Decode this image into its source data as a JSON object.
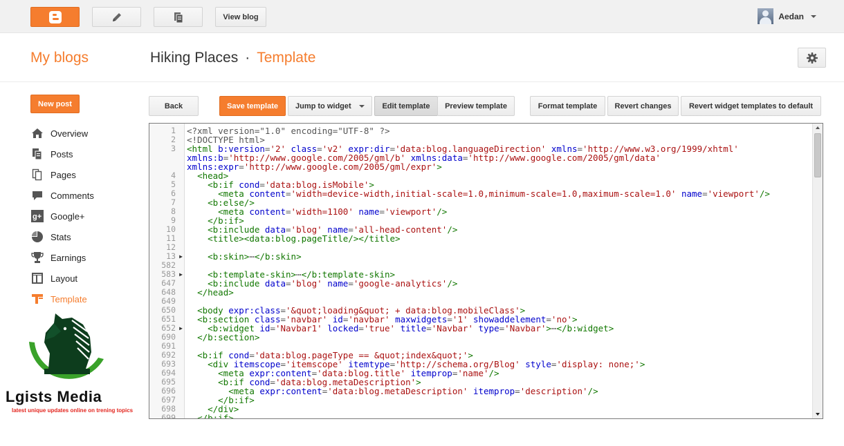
{
  "topbar": {
    "view_blog_label": "View blog",
    "user_name": "Aedan"
  },
  "header": {
    "my_blogs": "My blogs",
    "blog_name": "Hiking Places",
    "separator": "·",
    "page_name": "Template"
  },
  "sidebar": {
    "new_post_label": "New post",
    "items": [
      {
        "label": "Overview",
        "icon": "home-icon"
      },
      {
        "label": "Posts",
        "icon": "posts-icon"
      },
      {
        "label": "Pages",
        "icon": "pages-icon"
      },
      {
        "label": "Comments",
        "icon": "comments-icon"
      },
      {
        "label": "Google+",
        "icon": "google-plus-icon"
      },
      {
        "label": "Stats",
        "icon": "stats-icon"
      },
      {
        "label": "Earnings",
        "icon": "trophy-icon"
      },
      {
        "label": "Layout",
        "icon": "layout-icon"
      },
      {
        "label": "Template",
        "icon": "template-icon",
        "active": true
      }
    ]
  },
  "toolbar": {
    "back": "Back",
    "save": "Save template",
    "jump": "Jump to widget",
    "edit": "Edit template",
    "preview": "Preview template",
    "format": "Format template",
    "revert": "Revert changes",
    "revert_widgets": "Revert widget templates to default"
  },
  "logo": {
    "name": "Lgists Media",
    "tagline": "latest unique updates online on trening topics"
  },
  "colors": {
    "accent": "#f57d2e",
    "tag": "#117700",
    "attribute": "#0000cc",
    "string": "#aa1111"
  },
  "editor": {
    "lines": [
      {
        "n": "1",
        "fold": false,
        "tokens": [
          [
            "p",
            "<?xml version=\"1.0\" encoding=\"UTF-8\" ?>"
          ]
        ]
      },
      {
        "n": "2",
        "fold": false,
        "tokens": [
          [
            "p",
            "<!DOCTYPE html>"
          ]
        ]
      },
      {
        "n": "3",
        "fold": false,
        "tokens": [
          [
            "t",
            "<html "
          ],
          [
            "a",
            "b:version"
          ],
          [
            "p",
            "="
          ],
          [
            "s",
            "'2'"
          ],
          [
            "p",
            " "
          ],
          [
            "a",
            "class"
          ],
          [
            "p",
            "="
          ],
          [
            "s",
            "'v2'"
          ],
          [
            "p",
            " "
          ],
          [
            "a",
            "expr:dir"
          ],
          [
            "p",
            "="
          ],
          [
            "s",
            "'data:blog.languageDirection'"
          ],
          [
            "p",
            " "
          ],
          [
            "a",
            "xmlns"
          ],
          [
            "p",
            "="
          ],
          [
            "s",
            "'http://www.w3.org/1999/xhtml'"
          ]
        ]
      },
      {
        "n": "",
        "fold": false,
        "tokens": [
          [
            "a",
            "xmlns:b"
          ],
          [
            "p",
            "="
          ],
          [
            "s",
            "'http://www.google.com/2005/gml/b'"
          ],
          [
            "p",
            " "
          ],
          [
            "a",
            "xmlns:data"
          ],
          [
            "p",
            "="
          ],
          [
            "s",
            "'http://www.google.com/2005/gml/data'"
          ]
        ]
      },
      {
        "n": "",
        "fold": false,
        "tokens": [
          [
            "a",
            "xmlns:expr"
          ],
          [
            "p",
            "="
          ],
          [
            "s",
            "'http://www.google.com/2005/gml/expr'"
          ],
          [
            "t",
            ">"
          ]
        ]
      },
      {
        "n": "4",
        "fold": false,
        "tokens": [
          [
            "p",
            "  "
          ],
          [
            "t",
            "<head>"
          ]
        ]
      },
      {
        "n": "5",
        "fold": false,
        "tokens": [
          [
            "p",
            "    "
          ],
          [
            "t",
            "<b:if "
          ],
          [
            "a",
            "cond"
          ],
          [
            "p",
            "="
          ],
          [
            "s",
            "'data:blog.isMobile'"
          ],
          [
            "t",
            ">"
          ]
        ]
      },
      {
        "n": "6",
        "fold": false,
        "tokens": [
          [
            "p",
            "      "
          ],
          [
            "t",
            "<meta "
          ],
          [
            "a",
            "content"
          ],
          [
            "p",
            "="
          ],
          [
            "s",
            "'width=device-width,initial-scale=1.0,minimum-scale=1.0,maximum-scale=1.0'"
          ],
          [
            "p",
            " "
          ],
          [
            "a",
            "name"
          ],
          [
            "p",
            "="
          ],
          [
            "s",
            "'viewport'"
          ],
          [
            "t",
            "/>"
          ]
        ]
      },
      {
        "n": "7",
        "fold": false,
        "tokens": [
          [
            "p",
            "    "
          ],
          [
            "t",
            "<b:else/>"
          ]
        ]
      },
      {
        "n": "8",
        "fold": false,
        "tokens": [
          [
            "p",
            "      "
          ],
          [
            "t",
            "<meta "
          ],
          [
            "a",
            "content"
          ],
          [
            "p",
            "="
          ],
          [
            "s",
            "'width=1100'"
          ],
          [
            "p",
            " "
          ],
          [
            "a",
            "name"
          ],
          [
            "p",
            "="
          ],
          [
            "s",
            "'viewport'"
          ],
          [
            "t",
            "/>"
          ]
        ]
      },
      {
        "n": "9",
        "fold": false,
        "tokens": [
          [
            "p",
            "    "
          ],
          [
            "t",
            "</b:if>"
          ]
        ]
      },
      {
        "n": "10",
        "fold": false,
        "tokens": [
          [
            "p",
            "    "
          ],
          [
            "t",
            "<b:include "
          ],
          [
            "a",
            "data"
          ],
          [
            "p",
            "="
          ],
          [
            "s",
            "'blog'"
          ],
          [
            "p",
            " "
          ],
          [
            "a",
            "name"
          ],
          [
            "p",
            "="
          ],
          [
            "s",
            "'all-head-content'"
          ],
          [
            "t",
            "/>"
          ]
        ]
      },
      {
        "n": "11",
        "fold": false,
        "tokens": [
          [
            "p",
            "    "
          ],
          [
            "t",
            "<title>"
          ],
          [
            "t",
            "<data:blog.pageTitle/>"
          ],
          [
            "t",
            "</title>"
          ]
        ]
      },
      {
        "n": "12",
        "fold": false,
        "tokens": []
      },
      {
        "n": "13",
        "fold": true,
        "tokens": [
          [
            "p",
            "    "
          ],
          [
            "t",
            "<b:skin>"
          ],
          [
            "p",
            "⋯"
          ],
          [
            "t",
            "</b:skin>"
          ]
        ]
      },
      {
        "n": "582",
        "fold": false,
        "tokens": []
      },
      {
        "n": "583",
        "fold": true,
        "tokens": [
          [
            "p",
            "    "
          ],
          [
            "t",
            "<b:template-skin>"
          ],
          [
            "p",
            "⋯"
          ],
          [
            "t",
            "</b:template-skin>"
          ]
        ]
      },
      {
        "n": "647",
        "fold": false,
        "tokens": [
          [
            "p",
            "    "
          ],
          [
            "t",
            "<b:include "
          ],
          [
            "a",
            "data"
          ],
          [
            "p",
            "="
          ],
          [
            "s",
            "'blog'"
          ],
          [
            "p",
            " "
          ],
          [
            "a",
            "name"
          ],
          [
            "p",
            "="
          ],
          [
            "s",
            "'google-analytics'"
          ],
          [
            "t",
            "/>"
          ]
        ]
      },
      {
        "n": "648",
        "fold": false,
        "tokens": [
          [
            "p",
            "  "
          ],
          [
            "t",
            "</head>"
          ]
        ]
      },
      {
        "n": "649",
        "fold": false,
        "tokens": []
      },
      {
        "n": "650",
        "fold": false,
        "tokens": [
          [
            "p",
            "  "
          ],
          [
            "t",
            "<body "
          ],
          [
            "a",
            "expr:class"
          ],
          [
            "p",
            "="
          ],
          [
            "s",
            "'&quot;loading&quot; + data:blog.mobileClass'"
          ],
          [
            "t",
            ">"
          ]
        ]
      },
      {
        "n": "651",
        "fold": false,
        "tokens": [
          [
            "p",
            "  "
          ],
          [
            "t",
            "<b:section "
          ],
          [
            "a",
            "class"
          ],
          [
            "p",
            "="
          ],
          [
            "s",
            "'navbar'"
          ],
          [
            "p",
            " "
          ],
          [
            "a",
            "id"
          ],
          [
            "p",
            "="
          ],
          [
            "s",
            "'navbar'"
          ],
          [
            "p",
            " "
          ],
          [
            "a",
            "maxwidgets"
          ],
          [
            "p",
            "="
          ],
          [
            "s",
            "'1'"
          ],
          [
            "p",
            " "
          ],
          [
            "a",
            "showaddelement"
          ],
          [
            "p",
            "="
          ],
          [
            "s",
            "'no'"
          ],
          [
            "t",
            ">"
          ]
        ]
      },
      {
        "n": "652",
        "fold": true,
        "tokens": [
          [
            "p",
            "    "
          ],
          [
            "t",
            "<b:widget "
          ],
          [
            "a",
            "id"
          ],
          [
            "p",
            "="
          ],
          [
            "s",
            "'Navbar1'"
          ],
          [
            "p",
            " "
          ],
          [
            "a",
            "locked"
          ],
          [
            "p",
            "="
          ],
          [
            "s",
            "'true'"
          ],
          [
            "p",
            " "
          ],
          [
            "a",
            "title"
          ],
          [
            "p",
            "="
          ],
          [
            "s",
            "'Navbar'"
          ],
          [
            "p",
            " "
          ],
          [
            "a",
            "type"
          ],
          [
            "p",
            "="
          ],
          [
            "s",
            "'Navbar'"
          ],
          [
            "t",
            ">"
          ],
          [
            "p",
            "⋯"
          ],
          [
            "t",
            "</b:widget>"
          ]
        ]
      },
      {
        "n": "690",
        "fold": false,
        "tokens": [
          [
            "p",
            "  "
          ],
          [
            "t",
            "</b:section>"
          ]
        ]
      },
      {
        "n": "691",
        "fold": false,
        "tokens": []
      },
      {
        "n": "692",
        "fold": false,
        "tokens": [
          [
            "p",
            "  "
          ],
          [
            "t",
            "<b:if "
          ],
          [
            "a",
            "cond"
          ],
          [
            "p",
            "="
          ],
          [
            "s",
            "'data:blog.pageType == &quot;index&quot;'"
          ],
          [
            "t",
            ">"
          ]
        ]
      },
      {
        "n": "693",
        "fold": false,
        "tokens": [
          [
            "p",
            "    "
          ],
          [
            "t",
            "<div "
          ],
          [
            "a",
            "itemscope"
          ],
          [
            "p",
            "="
          ],
          [
            "s",
            "'itemscope'"
          ],
          [
            "p",
            " "
          ],
          [
            "a",
            "itemtype"
          ],
          [
            "p",
            "="
          ],
          [
            "s",
            "'http://schema.org/Blog'"
          ],
          [
            "p",
            " "
          ],
          [
            "a",
            "style"
          ],
          [
            "p",
            "="
          ],
          [
            "s",
            "'display: none;'"
          ],
          [
            "t",
            ">"
          ]
        ]
      },
      {
        "n": "694",
        "fold": false,
        "tokens": [
          [
            "p",
            "      "
          ],
          [
            "t",
            "<meta "
          ],
          [
            "a",
            "expr:content"
          ],
          [
            "p",
            "="
          ],
          [
            "s",
            "'data:blog.title'"
          ],
          [
            "p",
            " "
          ],
          [
            "a",
            "itemprop"
          ],
          [
            "p",
            "="
          ],
          [
            "s",
            "'name'"
          ],
          [
            "t",
            "/>"
          ]
        ]
      },
      {
        "n": "695",
        "fold": false,
        "tokens": [
          [
            "p",
            "      "
          ],
          [
            "t",
            "<b:if "
          ],
          [
            "a",
            "cond"
          ],
          [
            "p",
            "="
          ],
          [
            "s",
            "'data:blog.metaDescription'"
          ],
          [
            "t",
            ">"
          ]
        ]
      },
      {
        "n": "696",
        "fold": false,
        "tokens": [
          [
            "p",
            "        "
          ],
          [
            "t",
            "<meta "
          ],
          [
            "a",
            "expr:content"
          ],
          [
            "p",
            "="
          ],
          [
            "s",
            "'data:blog.metaDescription'"
          ],
          [
            "p",
            " "
          ],
          [
            "a",
            "itemprop"
          ],
          [
            "p",
            "="
          ],
          [
            "s",
            "'description'"
          ],
          [
            "t",
            "/>"
          ]
        ]
      },
      {
        "n": "697",
        "fold": false,
        "tokens": [
          [
            "p",
            "      "
          ],
          [
            "t",
            "</b:if>"
          ]
        ]
      },
      {
        "n": "698",
        "fold": false,
        "tokens": [
          [
            "p",
            "    "
          ],
          [
            "t",
            "</div>"
          ]
        ]
      },
      {
        "n": "699",
        "fold": false,
        "tokens": [
          [
            "p",
            "  "
          ],
          [
            "t",
            "</b:if>"
          ]
        ]
      }
    ]
  }
}
